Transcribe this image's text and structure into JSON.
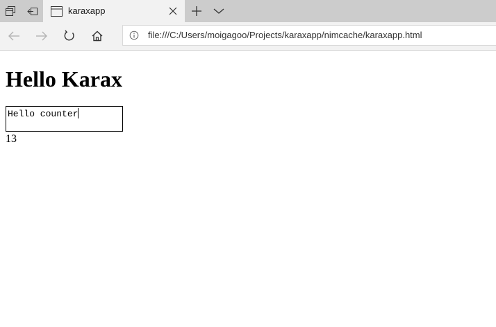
{
  "browser": {
    "tab": {
      "title": "karaxapp"
    },
    "address_bar": {
      "url": "file:///C:/Users/moigagoo/Projects/karaxapp/nimcache/karaxapp.html"
    },
    "icons": {
      "tab_manager": "tabs-aside-icon",
      "set_aside": "set-tabs-aside-icon",
      "page": "page-icon",
      "close": "close-icon",
      "new_tab": "plus-icon",
      "tab_preview": "chevron-down-icon",
      "back": "back-arrow-icon",
      "forward": "forward-arrow-icon",
      "refresh": "refresh-icon",
      "home": "home-icon",
      "info": "info-icon"
    }
  },
  "page": {
    "heading": "Hello Karax",
    "input_value": "Hello counter",
    "counter": "13"
  }
}
